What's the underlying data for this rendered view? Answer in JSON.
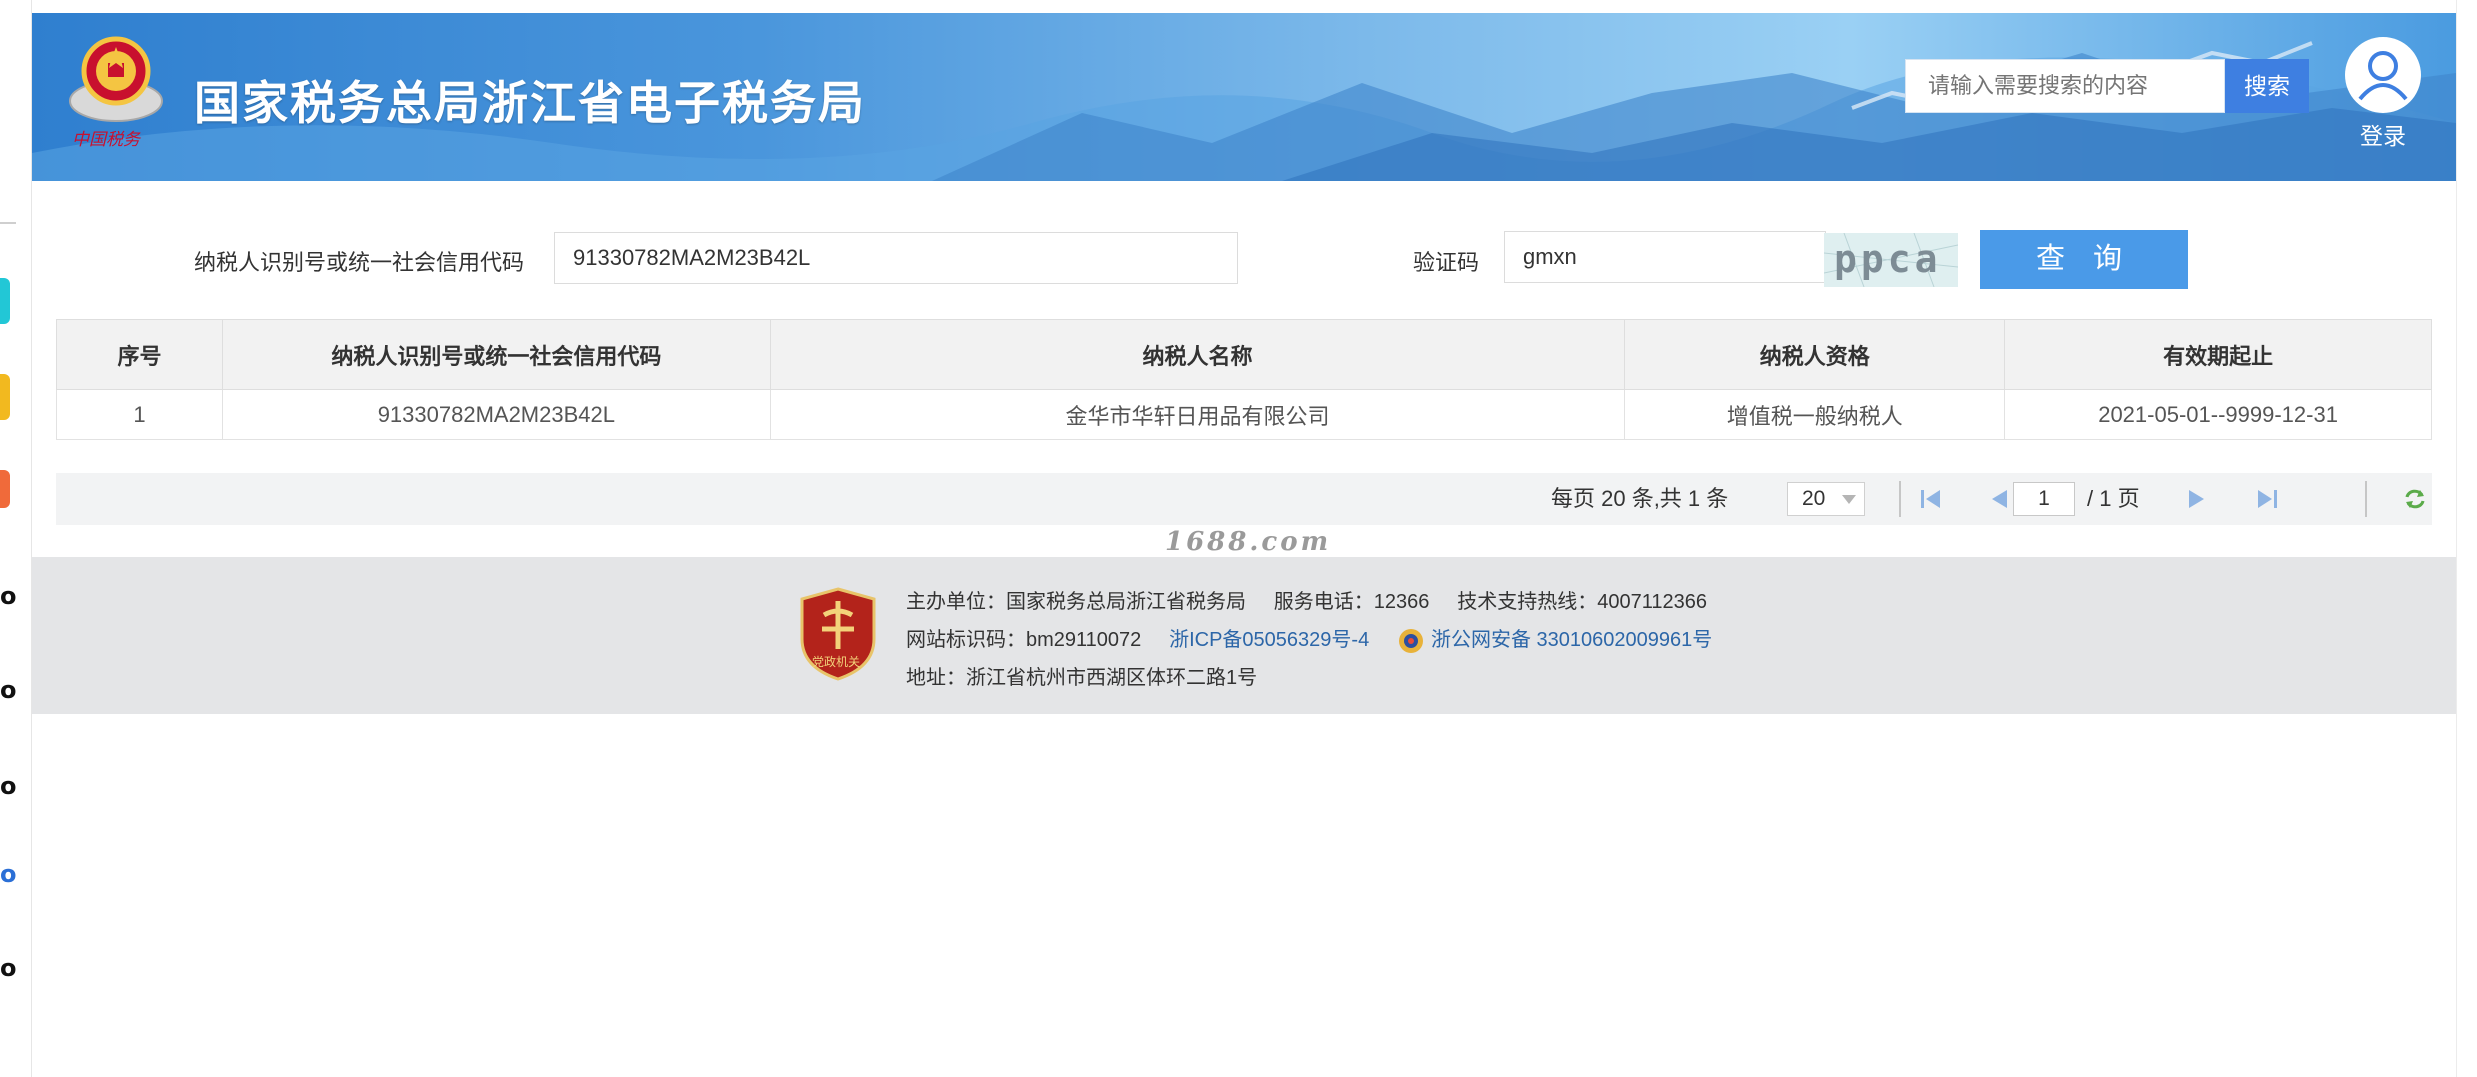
{
  "header": {
    "title": "国家税务总局浙江省电子税务局",
    "emblem_caption": "中国税务",
    "search_placeholder": "请输入需要搜索的内容",
    "search_button": "搜索",
    "login_label": "登录"
  },
  "query": {
    "taxpayer_id_label": "纳税人识别号或统一社会信用代码",
    "taxpayer_id_value": "91330782MA2M23B42L",
    "captcha_label": "验证码",
    "captcha_value": "gmxn",
    "captcha_image_text": "ppca",
    "submit_button": "查 询"
  },
  "table": {
    "columns": [
      "序号",
      "纳税人识别号或统一社会信用代码",
      "纳税人名称",
      "纳税人资格",
      "有效期起止"
    ],
    "rows": [
      [
        "1",
        "91330782MA2M23B42L",
        "金华市华轩日用品有限公司",
        "增值税一般纳税人",
        "2021-05-01--9999-12-31"
      ]
    ]
  },
  "pager": {
    "summary": "每页 20 条,共 1 条",
    "page_size": "20",
    "current_page": "1",
    "total_pages": "/ 1 页"
  },
  "watermark": "1688.com",
  "footer": {
    "badge_caption": "党政机关",
    "host_unit": "主办单位：国家税务总局浙江省税务局",
    "service_phone": "服务电话：12366",
    "tech_hotline": "技术支持热线：4007112366",
    "site_code": "网站标识码：bm29110072",
    "icp": "浙ICP备05056329号-4",
    "police_record": "浙公网安备 33010602009961号",
    "address": "地址：浙江省杭州市西湖区体环二路1号"
  },
  "colors": {
    "banner_blue": "#4a96dc",
    "search_button": "#3e7fe1",
    "query_button": "#4a9ae8",
    "link": "#2c66a8",
    "footer_bg": "#e4e5e7"
  }
}
